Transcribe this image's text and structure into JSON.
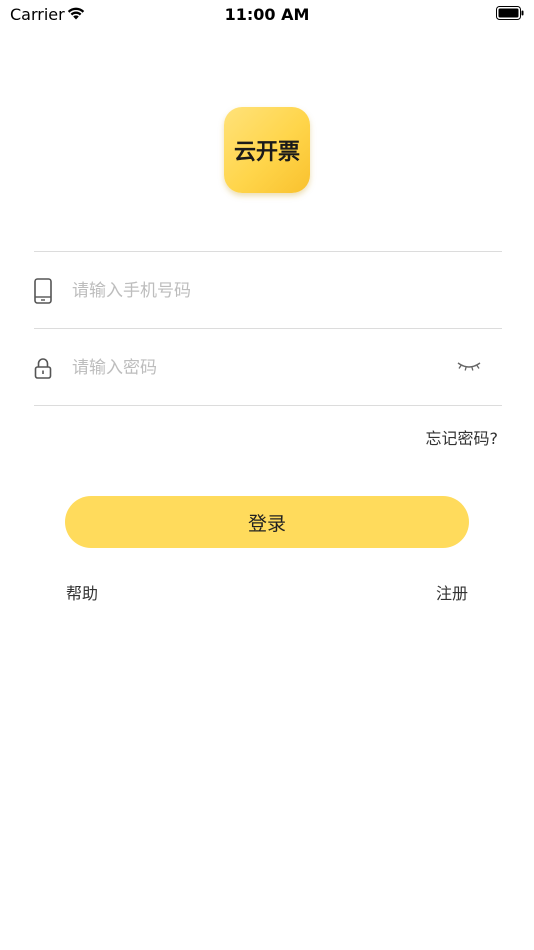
{
  "status_bar": {
    "carrier": "Carrier",
    "time": "11:00 AM"
  },
  "logo": {
    "text": "云开票"
  },
  "form": {
    "phone_placeholder": "请输入手机号码",
    "password_placeholder": "请输入密码",
    "forgot_password": "忘记密码?"
  },
  "actions": {
    "login": "登录",
    "help": "帮助",
    "register": "注册"
  },
  "colors": {
    "accent": "#ffdb5c",
    "logo_bg": "#ffd54a",
    "divider": "#dcdcdc",
    "placeholder": "#bdbdbd"
  },
  "icons": {
    "phone": "phone-icon",
    "lock": "lock-icon",
    "eye": "eye-closed-icon",
    "wifi": "wifi-icon",
    "battery": "battery-icon"
  }
}
